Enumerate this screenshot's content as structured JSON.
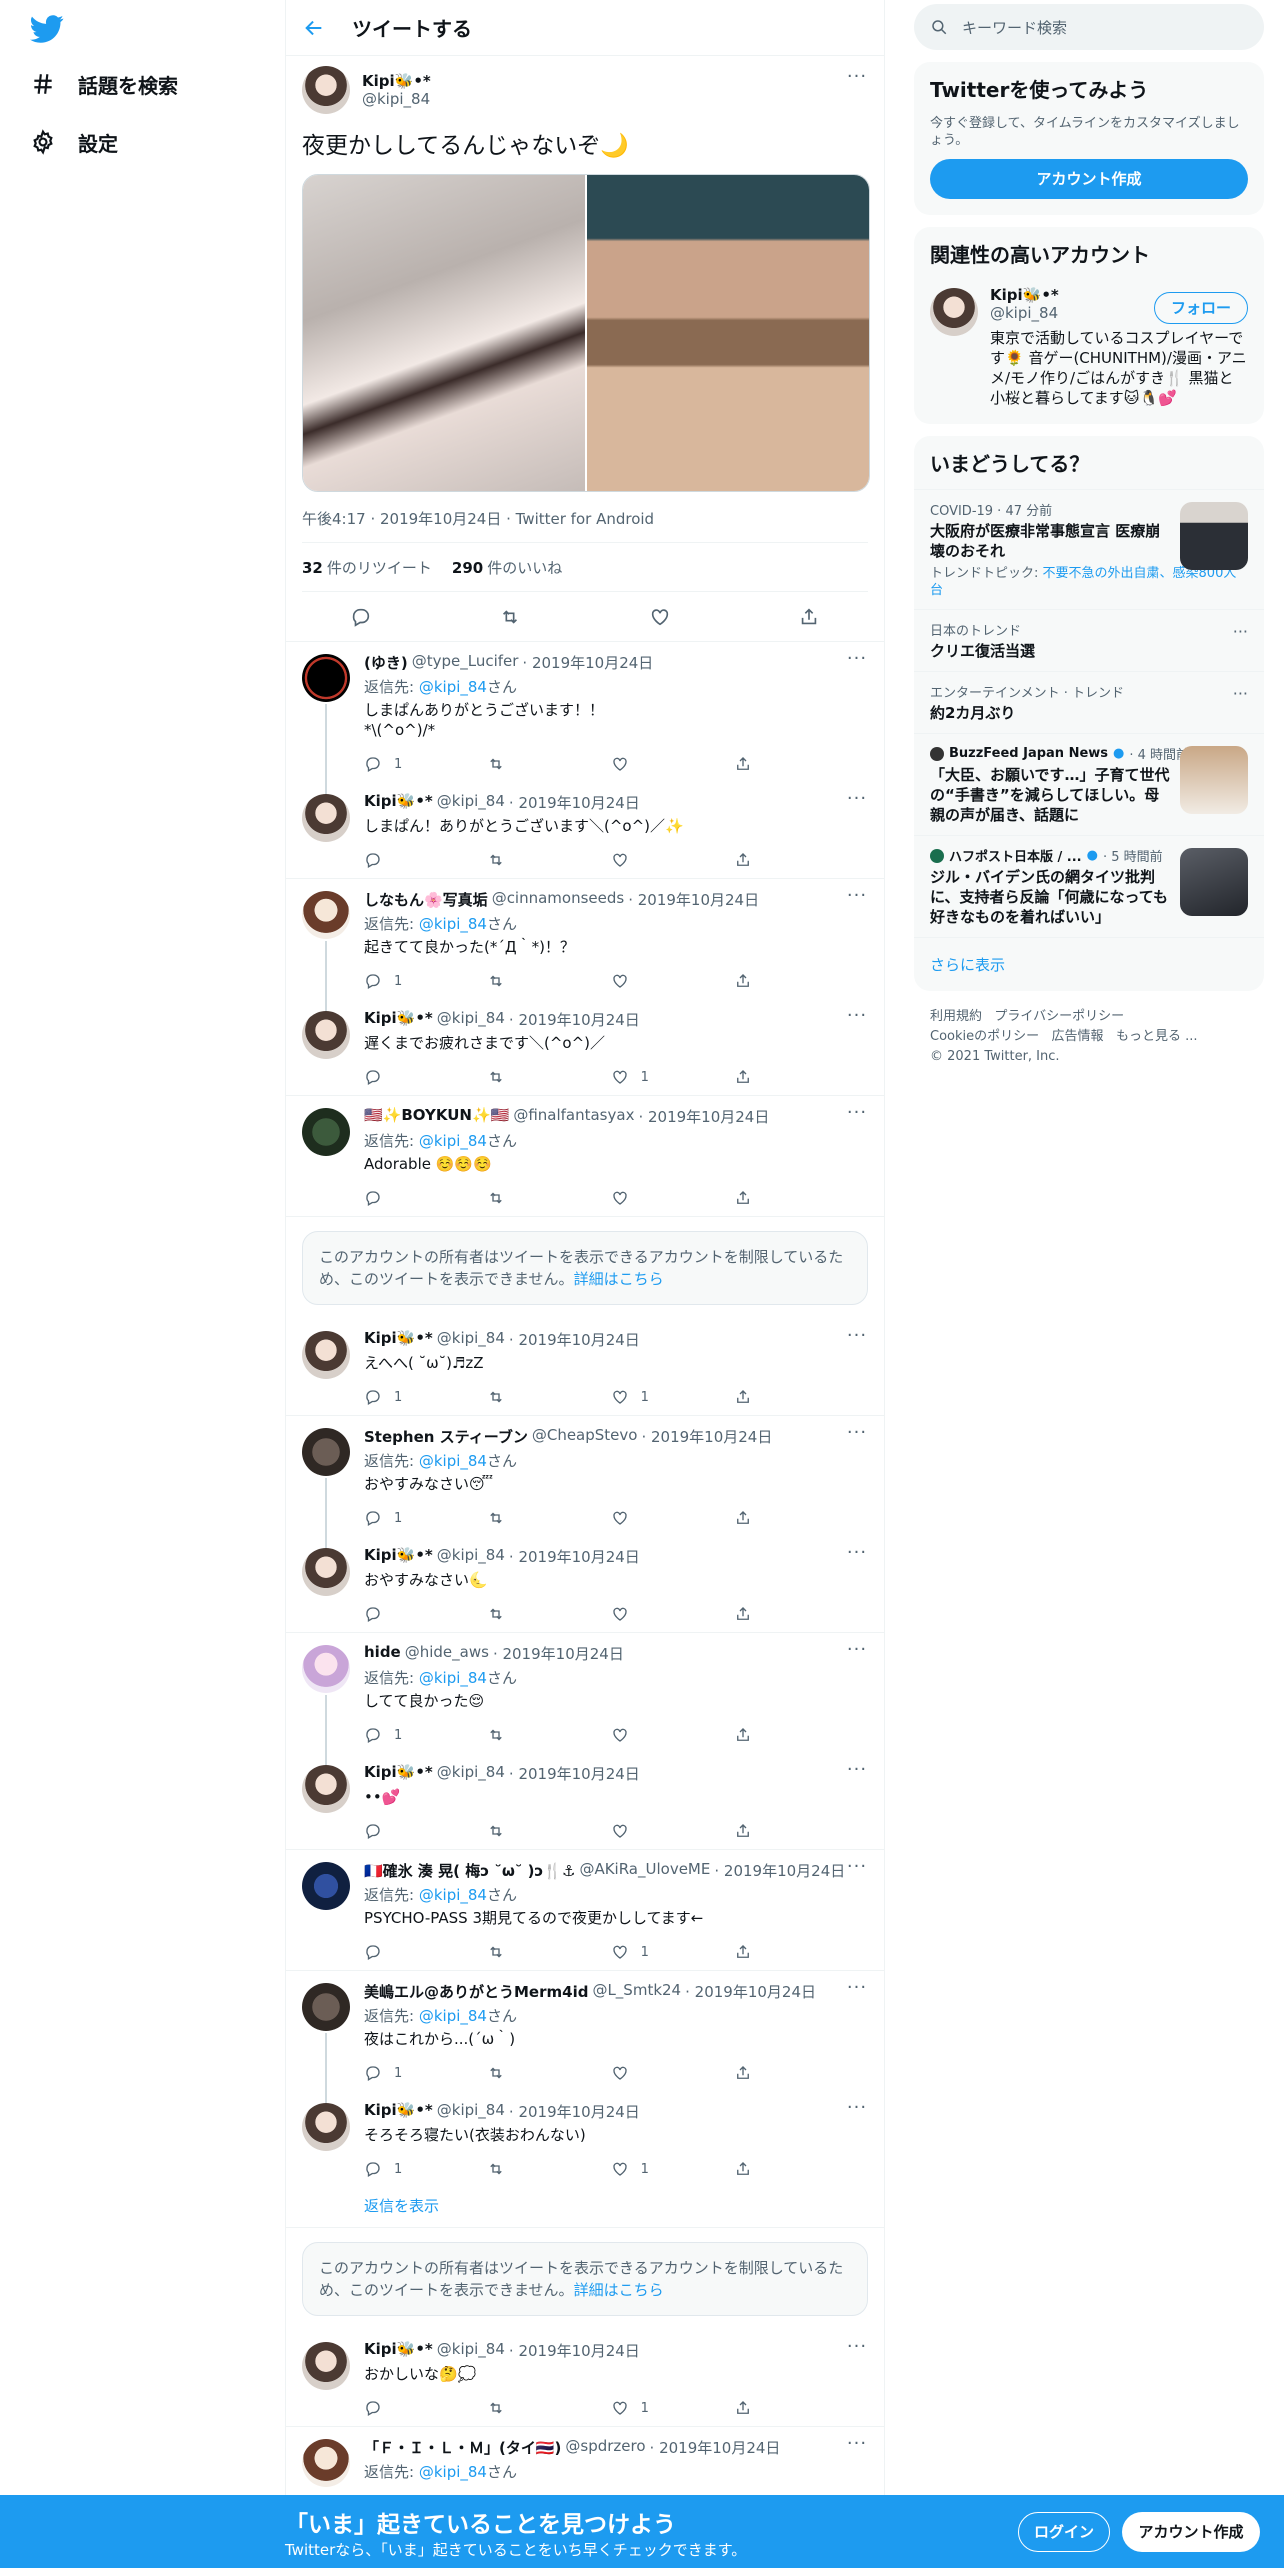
{
  "nav": {
    "explore_label": "話題を検索",
    "settings_label": "設定"
  },
  "header": {
    "title": "ツイートする"
  },
  "focal": {
    "name": "Kipi🐝•*",
    "handle": "@kipi_84",
    "text": "夜更かししてるんじゃないぞ🌙",
    "meta": "午後4:17 · 2019年10月24日 · Twitter for Android",
    "retweets": "32",
    "retweets_label": "件のリツイート",
    "likes": "290",
    "likes_label": "件のいいね"
  },
  "labels": {
    "replying_to": "返信先:",
    "san": "さん",
    "more": "···"
  },
  "replies": [
    {
      "name": "(ゆき)",
      "handle": "@type_Lucifer",
      "date": "· 2019年10月24日",
      "reply_to": "@kipi_84",
      "text": "しまぱんありがとうございます！！\n*\\(^o^)/*",
      "reply_count": "1",
      "like_count": ""
    },
    {
      "name": "Kipi🐝•*",
      "handle": "@kipi_84",
      "date": "· 2019年10月24日",
      "reply_to": "",
      "text": "しまぱん！ありがとうございます＼(^o^)／✨",
      "reply_count": "",
      "like_count": ""
    },
    {
      "name": "しなもん🌸写真垢",
      "handle": "@cinnamonseeds",
      "date": "· 2019年10月24日",
      "reply_to": "@kipi_84",
      "text": "起きてて良かった(*´Д｀*)！？",
      "reply_count": "1",
      "like_count": ""
    },
    {
      "name": "Kipi🐝•*",
      "handle": "@kipi_84",
      "date": "· 2019年10月24日",
      "reply_to": "",
      "text": "遅くまでお疲れさまです＼(^o^)／",
      "reply_count": "",
      "like_count": "1"
    },
    {
      "name": "🇺🇸✨BOYKUN✨🇺🇸",
      "handle": "@finalfantasyax",
      "date": "· 2019年10月24日",
      "reply_to": "@kipi_84",
      "text": "Adorable ☺️☺️☺️",
      "reply_count": "",
      "like_count": ""
    },
    {
      "name": "Kipi🐝•*",
      "handle": "@kipi_84",
      "date": "· 2019年10月24日",
      "reply_to": "",
      "text": "えへへ( ˘ω˘)♬zZ",
      "reply_count": "1",
      "like_count": "1"
    },
    {
      "name": "Stephen スティーブン",
      "handle": "@CheapStevo",
      "date": "· 2019年10月24日",
      "reply_to": "@kipi_84",
      "text": "おやすみなさい😴",
      "reply_count": "1",
      "like_count": ""
    },
    {
      "name": "Kipi🐝•*",
      "handle": "@kipi_84",
      "date": "· 2019年10月24日",
      "reply_to": "",
      "text": "おやすみなさい🌜",
      "reply_count": "",
      "like_count": ""
    },
    {
      "name": "hide",
      "handle": "@hide_aws",
      "date": "· 2019年10月24日",
      "reply_to": "@kipi_84",
      "text": "してて良かった😌",
      "reply_count": "1",
      "like_count": ""
    },
    {
      "name": "Kipi🐝•*",
      "handle": "@kipi_84",
      "date": "· 2019年10月24日",
      "reply_to": "",
      "text": "••💕",
      "reply_count": "",
      "like_count": ""
    },
    {
      "name": "🇫🇷確氷 湊 晃( 梅ɔ ˘ω˘ )ɔ🍴⚓",
      "handle": "@AKiRa_UloveME",
      "date": "· 2019年10月24日",
      "reply_to": "@kipi_84",
      "text": "PSYCHO-PASS 3期見てるので夜更かししてます←",
      "reply_count": "",
      "like_count": "1"
    },
    {
      "name": "美嶋エル@ありがとうMerm4id",
      "handle": "@L_Smtk24",
      "date": "· 2019年10月24日",
      "reply_to": "@kipi_84",
      "text": "夜はこれから...(´ω｀)",
      "reply_count": "1",
      "like_count": ""
    },
    {
      "name": "Kipi🐝•*",
      "handle": "@kipi_84",
      "date": "· 2019年10月24日",
      "reply_to": "",
      "text": "そろそろ寝たい(衣装おわんない)",
      "reply_count": "1",
      "like_count": "1"
    },
    {
      "name": "Kipi🐝•*",
      "handle": "@kipi_84",
      "date": "· 2019年10月24日",
      "reply_to": "",
      "text": "おかしいな🤔💭",
      "reply_count": "",
      "like_count": "1"
    },
    {
      "name": "「Ｆ・Ｉ・Ｌ・Ｍ」(タイ🇹🇭)",
      "handle": "@spdrzero",
      "date": "· 2019年10月24日",
      "reply_to": "@kipi_84",
      "text": "",
      "reply_count": "",
      "like_count": ""
    }
  ],
  "restricted": {
    "text": "このアカウントの所有者はツイートを表示できるアカウントを制限しているため、このツイートを表示できません。",
    "link": "詳細はこちら"
  },
  "show_replies": "返信を表示",
  "right": {
    "search_placeholder": "キーワード検索",
    "signup_title": "Twitterを使ってみよう",
    "signup_text": "今すぐ登録して、タイムラインをカスタマイズしましょう。",
    "signup_button": "アカウント作成",
    "related_title": "関連性の高いアカウント",
    "related_name": "Kipi🐝•*",
    "related_handle": "@kipi_84",
    "follow_label": "フォロー",
    "related_bio": "東京で活動しているコスプレイヤーです🌻 音ゲー(CHUNITHM)/漫画・アニメ/モノ作り/ごはんがすき🍴 黒猫と小桜と暮らしてます🐱🐧💕",
    "trends_title": "いまどうしてる？",
    "trends": [
      {
        "cat": "COVID-19 · 47 分前",
        "title": "大阪府が医療非常事態宣言 医療崩壊のおそれ",
        "sub_prefix": "トレンドトピック:",
        "sub_links": "不要不急の外出自粛、感染800人台"
      },
      {
        "cat": "日本のトレンド",
        "title": "クリエ復活当選"
      },
      {
        "cat": "エンターテインメント · トレンド",
        "title": "約2カ月ぶり"
      },
      {
        "source": "BuzzFeed Japan News",
        "time": "· 4 時間前",
        "title": "「大臣、お願いです…」子育て世代の“手書き”を減らしてほしい。母親の声が届き、話題に"
      },
      {
        "source": "ハフポスト日本版 / ...",
        "time": "· 5 時間前",
        "title": "ジル・バイデン氏の網タイツ批判に、支持者ら反論「何歳になっても好きなものを着ればいい」"
      }
    ],
    "show_more": "さらに表示",
    "footer_links": [
      "利用規約",
      "プライバシーポリシー",
      "Cookieのポリシー",
      "広告情報",
      "もっと見る ..."
    ],
    "copyright": "© 2021 Twitter, Inc."
  },
  "bottom": {
    "headline": "「いま」起きていることを見つけよう",
    "subline": "Twitterなら、「いま」起きていることをいち早くチェックできます。",
    "login": "ログイン",
    "signup": "アカウント作成"
  },
  "colors": {
    "accent": "#1d9bf0",
    "text": "#0f1419",
    "muted": "#536471"
  }
}
